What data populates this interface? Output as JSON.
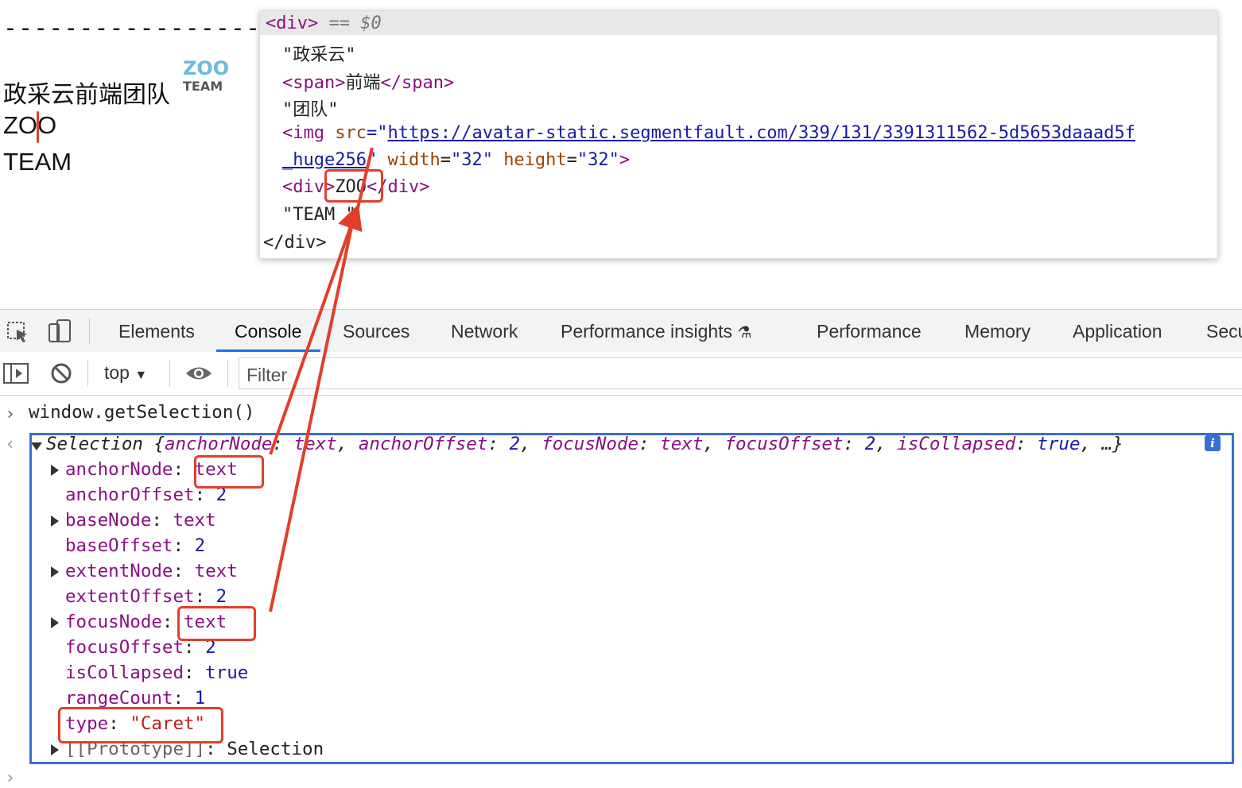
{
  "page": {
    "dashes": "-----------------------",
    "line1": "政采云前端团队",
    "logo_text_top": "ZOO",
    "logo_text_bottom": "TEAM",
    "line2": "ZOO",
    "line3": "TEAM"
  },
  "elements_popup": {
    "line0_open": "<div>",
    "line0_eq": "==",
    "line0_ref": "$0",
    "line1": "\"政采云\"",
    "line2_open": "<span>",
    "line2_text": "前端",
    "line2_close": "</span>",
    "line3": "\"团队\"",
    "line4_open": "<img",
    "line4_attr": "src",
    "line4_url1": "https://avatar-static.segmentfault.com/339/131/3391311562-5d5653daaad5f",
    "line5_url2": "_huge256",
    "line5_attr_w": "width",
    "line5_val_w": "\"32\"",
    "line5_attr_h": "height",
    "line5_val_h": "\"32\"",
    "line6_open": "<div>",
    "line6_text": "ZOO",
    "line6_close": "</div>",
    "line7": "\"TEAM \"",
    "line8": "</div>"
  },
  "devtools": {
    "tabs": [
      "Elements",
      "Console",
      "Sources",
      "Network",
      "Performance insights",
      "Performance",
      "Memory",
      "Application",
      "Secu"
    ],
    "active_tab": "Console",
    "context": "top",
    "filter_placeholder": "Filter"
  },
  "console": {
    "input": "window.getSelection()",
    "summary": {
      "prefix": "Selection",
      "anchorNode_key": "anchorNode",
      "anchorNode_val": "text",
      "anchorOffset_key": "anchorOffset",
      "anchorOffset_val": "2",
      "focusNode_key": "focusNode",
      "focusNode_val": "text",
      "focusOffset_key": "focusOffset",
      "focusOffset_val": "2",
      "isCollapsed_key": "isCollapsed",
      "isCollapsed_val": "true",
      "ellipsis": "…}"
    },
    "props": [
      {
        "key": "anchorNode",
        "value": "text",
        "expandable": true
      },
      {
        "key": "anchorOffset",
        "value": "2",
        "expandable": false
      },
      {
        "key": "baseNode",
        "value": "text",
        "expandable": true
      },
      {
        "key": "baseOffset",
        "value": "2",
        "expandable": false
      },
      {
        "key": "extentNode",
        "value": "text",
        "expandable": true
      },
      {
        "key": "extentOffset",
        "value": "2",
        "expandable": false
      },
      {
        "key": "focusNode",
        "value": "text",
        "expandable": true
      },
      {
        "key": "focusOffset",
        "value": "2",
        "expandable": false
      },
      {
        "key": "isCollapsed",
        "value": "true",
        "expandable": false
      },
      {
        "key": "rangeCount",
        "value": "1",
        "expandable": false
      },
      {
        "key": "type",
        "value": "\"Caret\"",
        "expandable": false
      },
      {
        "key": "[[Prototype]]",
        "value": "Selection",
        "expandable": true
      }
    ]
  },
  "colors": {
    "annotation_red": "#e13f2b",
    "selection_box_blue": "#3a6fd1",
    "tag_purple": "#881280",
    "number_blue": "#1a1aa6",
    "string_red": "#c41a16"
  }
}
